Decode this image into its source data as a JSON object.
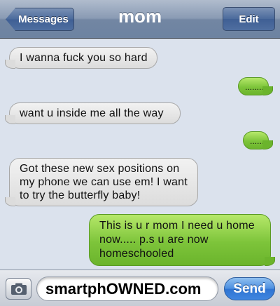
{
  "header": {
    "back_label": "Messages",
    "title": "mom",
    "edit_label": "Edit"
  },
  "messages": [
    {
      "from": "them",
      "text": "I wanna fuck you so hard"
    },
    {
      "from": "me",
      "text": "........"
    },
    {
      "from": "them",
      "text": "want u inside me all the way"
    },
    {
      "from": "me",
      "text": "......"
    },
    {
      "from": "them",
      "text": "Got these new sex positions on my phone we can use em! I want to try the butterfly baby!"
    },
    {
      "from": "me",
      "text": "This is u r mom I need u home now..... p.s u are now homeschooled"
    }
  ],
  "composer": {
    "input_value": "smartphOWNED.com",
    "send_label": "Send",
    "camera_icon": "camera-icon"
  },
  "colors": {
    "outgoing_bubble": "#7dc43a",
    "incoming_bubble": "#dcdcdc",
    "background": "#dbe2ed",
    "send_button": "#3f86e0"
  }
}
